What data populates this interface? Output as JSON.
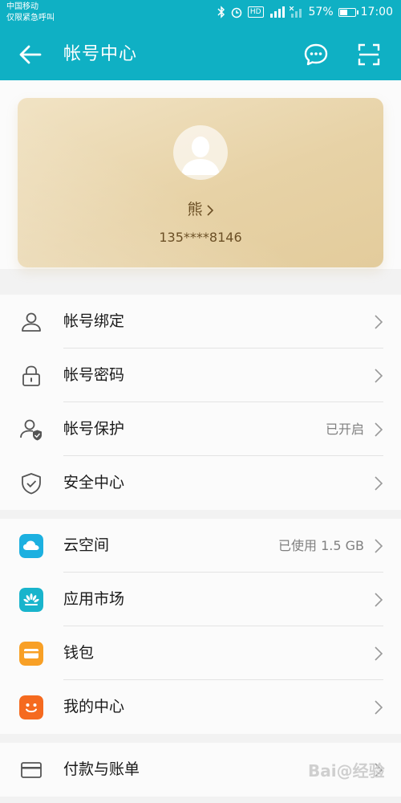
{
  "status_bar": {
    "carrier": "中国移动",
    "emergency": "仅限紧急呼叫",
    "battery": "57%",
    "battery_level": 0.57,
    "time": "17:00",
    "hd": "HD"
  },
  "header": {
    "title": "帐号中心"
  },
  "profile": {
    "name": "熊",
    "phone": "135****8146"
  },
  "account_group": [
    {
      "label": "帐号绑定",
      "value": "",
      "icon": "person-icon"
    },
    {
      "label": "帐号密码",
      "value": "",
      "icon": "lock-icon"
    },
    {
      "label": "帐号保护",
      "value": "已开启",
      "icon": "person-shield-icon"
    },
    {
      "label": "安全中心",
      "value": "",
      "icon": "shield-check-icon"
    }
  ],
  "services_group": [
    {
      "label": "云空间",
      "value": "已使用 1.5 GB",
      "icon": "cloud-icon",
      "color": "#1cb0e0"
    },
    {
      "label": "应用市场",
      "value": "",
      "icon": "app-market-icon",
      "color": "#19b4cc"
    },
    {
      "label": "钱包",
      "value": "",
      "icon": "wallet-icon",
      "color": "#f8a026"
    },
    {
      "label": "我的中心",
      "value": "",
      "icon": "smiley-icon",
      "color": "#f56a1f"
    }
  ],
  "payment_group": [
    {
      "label": "付款与账单",
      "value": "",
      "icon": "card-icon"
    }
  ],
  "colors": {
    "accent": "#0fb0c4",
    "card_gold": "#e7d2a6",
    "name_brown": "#6b4f25"
  },
  "watermark": "Bai@经验"
}
